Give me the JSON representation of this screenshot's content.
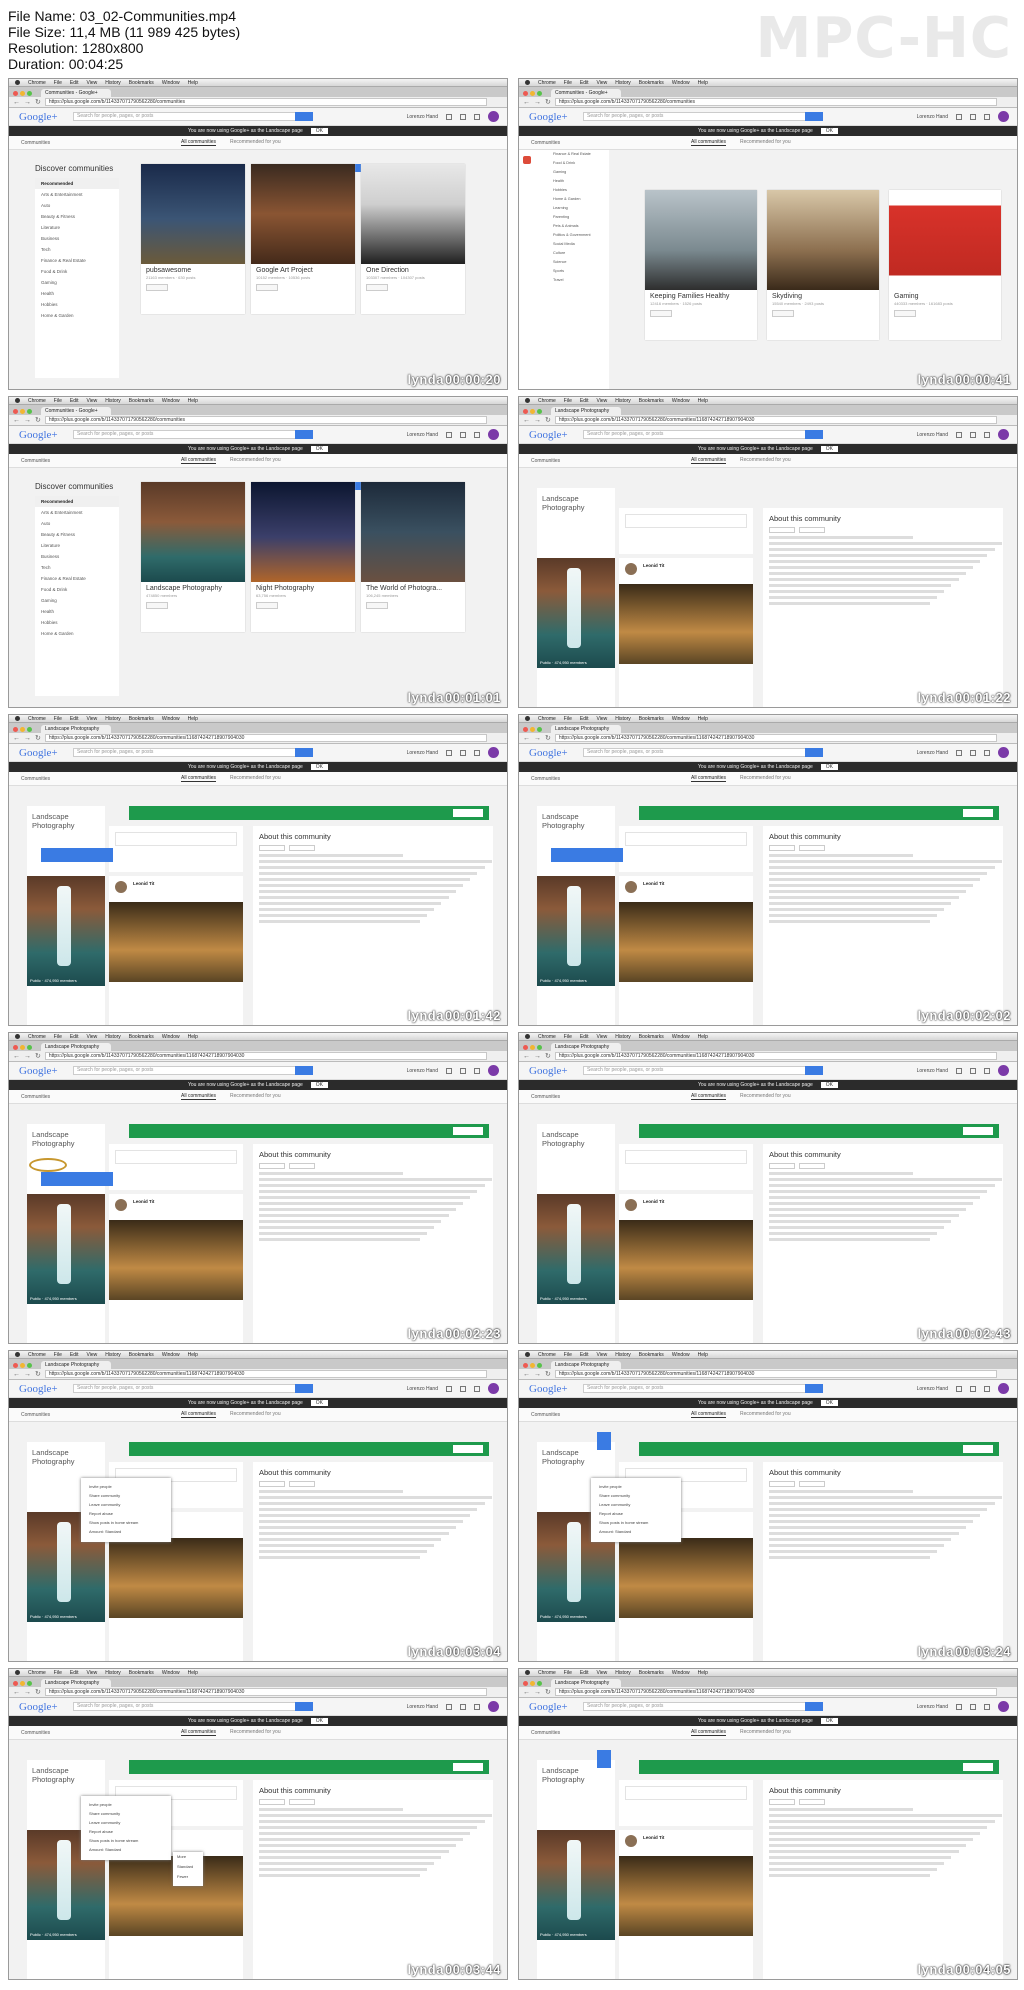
{
  "file_info": {
    "file_name": "File Name: 03_02-Communities.mp4",
    "file_size": "File Size: 11,4 MB (11 989 425 bytes)",
    "resolution": "Resolution: 1280x800",
    "duration": "Duration: 00:04:25"
  },
  "player_logo": "MPC-HC",
  "watermark": "lynda",
  "mac_menu": [
    "Chrome",
    "File",
    "Edit",
    "View",
    "History",
    "Bookmarks",
    "Window",
    "Help"
  ],
  "google": {
    "logo": "Google+",
    "search_placeholder": "Search for people, pages, or posts",
    "user_name": "Lorenzo Hand",
    "notice": "You are now using Google+ as the Landscape page",
    "notice_button": "OK",
    "communities_drop": "Communities",
    "tab_all": "All communities",
    "tab_rec": "Recommended for you"
  },
  "frames": [
    {
      "time": "00:00:20",
      "tab": "Communities - Google+",
      "url": "https://plus.google.com/b/114337071790562280/communities",
      "view": "discover",
      "heading": "Discover communities",
      "categories": [
        "Recommended",
        "Arts & Entertainment",
        "Auto",
        "Beauty & Fitness",
        "Literature",
        "Business",
        "Tech",
        "Finance & Real Estate",
        "Food & Drink",
        "Gaming",
        "Health",
        "Hobbies",
        "Home & Garden"
      ],
      "cards": [
        {
          "name": "pubsawesome",
          "stats": "21163 members · 630 posts"
        },
        {
          "name": "Google Art Project",
          "stats": "10152 members · 10536 posts"
        },
        {
          "name": "One Direction",
          "stats": "103307 members · 104307 posts"
        }
      ]
    },
    {
      "time": "00:00:41",
      "tab": "Communities - Google+",
      "url": "https://plus.google.com/b/114337071790562280/communities",
      "view": "discover-scroll",
      "categories": [
        "Finance & Real Estate",
        "Food & Drink",
        "Gaming",
        "Health",
        "Hobbies",
        "Home & Garden",
        "Learning",
        "Parenting",
        "Pets & Animals",
        "Politics & Government",
        "Social Media",
        "Culture",
        "Science",
        "Sports",
        "Travel"
      ],
      "cards": [
        {
          "name": "Keeping Families Healthy",
          "stats": "12416 members · 1526 posts"
        },
        {
          "name": "Skydiving",
          "stats": "15540 members · 2493 posts"
        },
        {
          "name": "Gaming",
          "stats": "440333 members · 161683 posts"
        }
      ]
    },
    {
      "time": "00:01:01",
      "tab": "Communities - Google+",
      "url": "https://plus.google.com/b/114337071790562280/communities",
      "view": "discover",
      "heading": "Discover communities",
      "categories": [
        "Recommended",
        "Arts & Entertainment",
        "Auto",
        "Beauty & Fitness",
        "Literature",
        "Business",
        "Tech",
        "Finance & Real Estate",
        "Food & Drink",
        "Gaming",
        "Health",
        "Hobbies",
        "Home & Garden"
      ],
      "cards": [
        {
          "name": "Landscape Photography",
          "stats": "474850 members"
        },
        {
          "name": "Night Photography",
          "stats": "63,756 members"
        },
        {
          "name": "The World of Photogra...",
          "stats": "106,245 members"
        }
      ]
    },
    {
      "time": "00:01:22",
      "tab": "Landscape Photography",
      "url": "https://plus.google.com/b/114337071790562280/communities/116874242718907904030",
      "view": "community-intro",
      "community": "Landscape Photography",
      "members": "Public · 474,950 members",
      "author": "Leonid Tit",
      "about": "About this community"
    },
    {
      "time": "00:01:42",
      "tab": "Landscape Photography",
      "url": "https://plus.google.com/b/114337071790562280/communities/116874242718907904030",
      "view": "community",
      "community": "Landscape Photography",
      "members": "Public · 474,950 members",
      "author": "Leonid Tit",
      "about": "About this community",
      "overlay": "tooltip"
    },
    {
      "time": "00:02:02",
      "tab": "Landscape Photography",
      "url": "https://plus.google.com/b/114337071790562280/communities/116874242718907904030",
      "view": "community",
      "community": "Landscape Photography",
      "members": "Public · 474,950 members",
      "author": "Leonid Tit",
      "about": "About this community",
      "overlay": "tooltip"
    },
    {
      "time": "00:02:23",
      "tab": "Landscape Photography",
      "url": "https://plus.google.com/b/114337071790562280/communities/116874242718907904030",
      "view": "community",
      "community": "Landscape Photography",
      "members": "Public · 474,950 members",
      "author": "Leonid Tit",
      "about": "About this community",
      "overlay": "ring"
    },
    {
      "time": "00:02:43",
      "tab": "Landscape Photography",
      "url": "https://plus.google.com/b/114337071790562280/communities/116874242718907904030",
      "view": "community",
      "community": "Landscape Photography",
      "members": "Public · 474,950 members",
      "author": "Leonid Tit",
      "about": "About this community",
      "overlay": "none"
    },
    {
      "time": "00:03:04",
      "tab": "Landscape Photography",
      "url": "https://plus.google.com/b/114337071790562280/communities/116874242718907904030",
      "view": "community",
      "community": "Landscape Photography",
      "members": "Public · 474,950 members",
      "author": "Leonid Tit",
      "about": "About this community",
      "overlay": "menu",
      "menu": [
        "Invite people",
        "Share community",
        "Leave community",
        "Report abuse",
        "Show posts in home stream",
        "Amount: Standard"
      ]
    },
    {
      "time": "00:03:24",
      "tab": "Landscape Photography",
      "url": "https://plus.google.com/b/114337071790562280/communities/116874242718907904030",
      "view": "community",
      "community": "Landscape Photography",
      "members": "Public · 474,950 members",
      "author": "Leonid Tit",
      "about": "About this community",
      "overlay": "menu-plus",
      "menu": [
        "Invite people",
        "Share community",
        "Leave community",
        "Report abuse",
        "Show posts in home stream",
        "Amount: Standard"
      ]
    },
    {
      "time": "00:03:44",
      "tab": "Landscape Photography",
      "url": "https://plus.google.com/b/114337071790562280/communities/116874242718907904030",
      "view": "community",
      "community": "Landscape Photography",
      "members": "Public · 474,950 members",
      "author": "Leonid Tit",
      "about": "About this community",
      "overlay": "submenu",
      "menu": [
        "Invite people",
        "Share community",
        "Leave community",
        "Report abuse",
        "Show posts in home stream",
        "Amount: Standard"
      ],
      "submenu": [
        "More",
        "Standard",
        "Fewer"
      ]
    },
    {
      "time": "00:04:05",
      "tab": "Landscape Photography",
      "url": "https://plus.google.com/b/114337071790562280/communities/116874242718907904030",
      "view": "community",
      "community": "Landscape Photography",
      "members": "Public · 474,950 members",
      "author": "Leonid Tit",
      "about": "About this community",
      "overlay": "plus"
    }
  ]
}
